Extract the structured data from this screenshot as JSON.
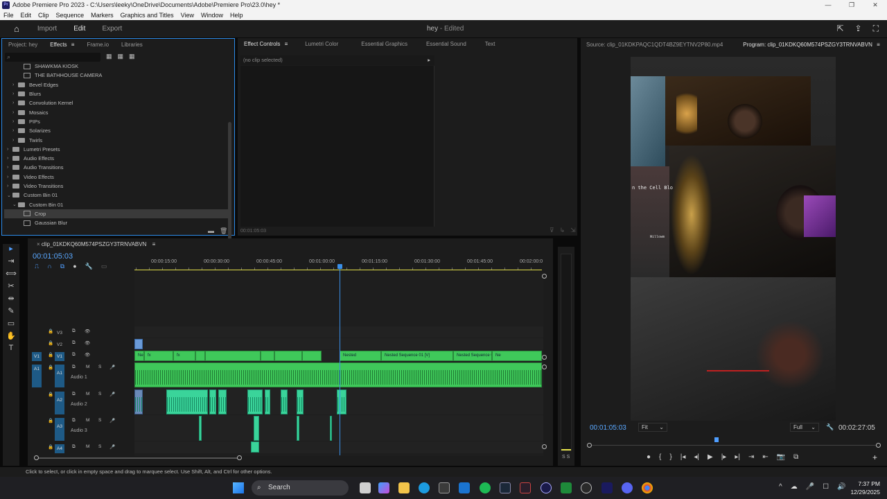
{
  "window": {
    "title": "Adobe Premiere Pro 2023 - C:\\Users\\leeky\\OneDrive\\Documents\\Adobe\\Premiere Pro\\23.0\\hey *",
    "app_badge": "Pr",
    "controls": [
      "—",
      "❐",
      "✕"
    ]
  },
  "menu": [
    "File",
    "Edit",
    "Clip",
    "Sequence",
    "Markers",
    "Graphics and Titles",
    "View",
    "Window",
    "Help"
  ],
  "workspace": {
    "home_icon": "⌂",
    "tabs": [
      "Import",
      "Edit",
      "Export"
    ],
    "active": "Edit",
    "doc_title": "hey",
    "doc_status": "- Edited",
    "right_icons": [
      "⇱",
      "⇪",
      "⛶"
    ]
  },
  "project_panel": {
    "tabs": [
      "Project: hey",
      "Effects",
      "Frame.io",
      "Libraries"
    ],
    "active_tab": "Effects",
    "menu_glyph": "≡",
    "search_icon": "⌕",
    "bin_icons": [
      "▦",
      "▦",
      "▦"
    ],
    "tree": [
      {
        "label": "SHAWKMA KIOSK",
        "indent": 2,
        "type": "fx",
        "expand": ""
      },
      {
        "label": "THE BATHHOUSE CAMERA",
        "indent": 2,
        "type": "fx",
        "expand": ""
      },
      {
        "label": "Bevel Edges",
        "indent": 1,
        "type": "folder",
        "expand": "›"
      },
      {
        "label": "Blurs",
        "indent": 1,
        "type": "folder",
        "expand": "›"
      },
      {
        "label": "Convolution Kernel",
        "indent": 1,
        "type": "folder",
        "expand": "›"
      },
      {
        "label": "Mosaics",
        "indent": 1,
        "type": "folder",
        "expand": "›"
      },
      {
        "label": "PIPs",
        "indent": 1,
        "type": "folder",
        "expand": "›"
      },
      {
        "label": "Solarizes",
        "indent": 1,
        "type": "folder",
        "expand": "›"
      },
      {
        "label": "Twirls",
        "indent": 1,
        "type": "folder",
        "expand": "›"
      },
      {
        "label": "Lumetri Presets",
        "indent": 0,
        "type": "folder",
        "expand": "›"
      },
      {
        "label": "Audio Effects",
        "indent": 0,
        "type": "folder",
        "expand": "›"
      },
      {
        "label": "Audio Transitions",
        "indent": 0,
        "type": "folder",
        "expand": "›"
      },
      {
        "label": "Video Effects",
        "indent": 0,
        "type": "folder",
        "expand": "›"
      },
      {
        "label": "Video Transitions",
        "indent": 0,
        "type": "folder",
        "expand": "›"
      },
      {
        "label": "Custom Bin 01",
        "indent": 0,
        "type": "folder",
        "expand": "⌄"
      },
      {
        "label": "Custom Bin 01",
        "indent": 1,
        "type": "folder",
        "expand": "⌄"
      },
      {
        "label": "Crop",
        "indent": 2,
        "type": "fx",
        "expand": "",
        "selected": true
      },
      {
        "label": "Gaussian Blur",
        "indent": 2,
        "type": "fx",
        "expand": ""
      }
    ],
    "footer_icons": [
      "▬",
      "🗑"
    ]
  },
  "effect_controls": {
    "tabs": [
      "Effect Controls",
      "Lumetri Color",
      "Essential Graphics",
      "Essential Sound",
      "Text"
    ],
    "active_tab": "Effect Controls",
    "menu_glyph": "≡",
    "no_clip": "(no clip selected)",
    "play_glyph": "▸",
    "timecode": "00:01:05:03",
    "footer_icons": [
      "⊽",
      "↳",
      "⇲"
    ]
  },
  "program_monitor": {
    "source_tab": "Source: clip_01KDKPAQC1QDT4BZ9EYTNV2P80.mp4",
    "program_tab": "Program: clip_01KDKQ60M574PSZGY3TRNVABVN",
    "menu_glyph": "≡",
    "overlay_text_1": "n the Cell Blo",
    "overlay_text_2": "Willowm",
    "timecode": "00:01:05:03",
    "fit": "Fit",
    "quality": "Full",
    "duration": "00:02:27:05",
    "playhead_fraction": 0.44,
    "dropdown_glyph": "⌄",
    "wrench_icon": "🔧",
    "transport": [
      "●",
      "{",
      "}",
      "|◂",
      "◂|",
      "▶",
      "|▸",
      "▸|",
      "⇥",
      "⇤",
      "📷",
      "⧉"
    ],
    "add_glyph": "+"
  },
  "tools": [
    "▸",
    "⇥",
    "⟺",
    "✂",
    "⇹",
    "✎",
    "▭",
    "✋",
    "T"
  ],
  "timeline": {
    "close_glyph": "×",
    "sequence_name": "clip_01KDKQ60M574PSZGY3TRNVABVN",
    "menu_glyph": "≡",
    "timecode": "00:01:05:03",
    "toolbar_icons": [
      "⎍",
      "∩",
      "⧉",
      "●",
      "🔧",
      "▭"
    ],
    "ruler": [
      "00:00:15:00",
      "00:00:30:00",
      "00:00:45:00",
      "00:01:00:00",
      "00:01:15:00",
      "00:01:30:00",
      "00:01:45:00",
      "00:02:00:0"
    ],
    "track_glyphs": {
      "lock": "🔒",
      "sync": "⧉",
      "eye": "👁",
      "mute": "M",
      "solo": "S",
      "mic": "🎤"
    },
    "video_tracks": [
      {
        "target": "",
        "name": "V3"
      },
      {
        "target": "",
        "name": "V2"
      },
      {
        "target": "V1",
        "name": "V1"
      }
    ],
    "audio_tracks": [
      {
        "target": "A1",
        "name": "A1",
        "label": "Audio 1"
      },
      {
        "target": "",
        "name": "A2",
        "label": "Audio 2"
      },
      {
        "target": "",
        "name": "A3",
        "label": "Audio 3"
      },
      {
        "target": "",
        "name": "A4",
        "label": ""
      }
    ],
    "v1_clips": [
      {
        "label": "Nes"
      },
      {
        "label": "fx"
      },
      {
        "label": "fx"
      },
      {
        "label": ""
      },
      {
        "label": ""
      },
      {
        "label": ""
      },
      {
        "label": ""
      },
      {
        "label": ""
      },
      {
        "label": "Nested"
      },
      {
        "label": "Nested Sequence 01 [V]"
      },
      {
        "label": "Nested Sequence 01 ["
      },
      {
        "label": "Ne"
      }
    ],
    "meter_label": "S S"
  },
  "status": "Click to select, or click in empty space and drag to marquee select. Use Shift, Alt, and Ctrl for other options.",
  "taskbar": {
    "search": "Search",
    "search_icon": "⌕",
    "tray": [
      "^",
      "☁",
      "🎤",
      "☐",
      "🔊"
    ],
    "time": "7:37 PM",
    "date": "12/29/2025"
  }
}
